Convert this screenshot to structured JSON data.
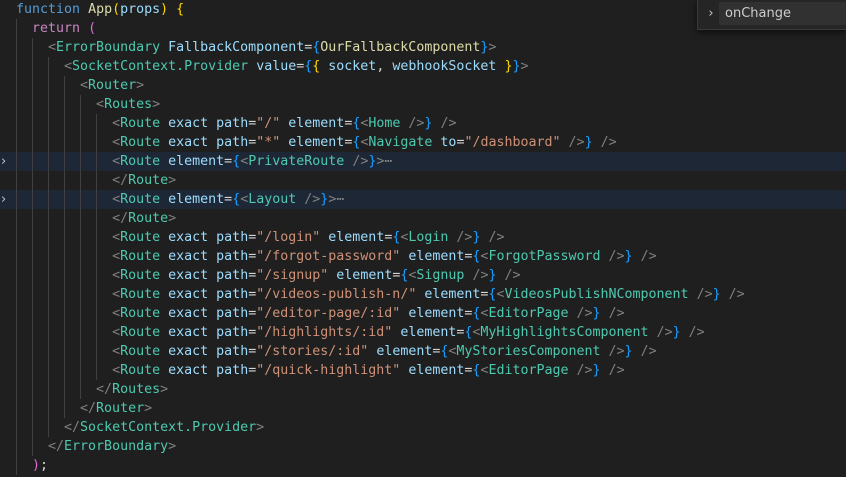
{
  "find_widget": {
    "toggle_icon": "chevron-right-icon",
    "toggle_glyph": "›",
    "query": "onChange"
  },
  "fold_glyph": "›",
  "code_lines": [
    {
      "indent": 0,
      "tokens": [
        [
          "k",
          "function"
        ],
        [
          "o",
          " "
        ],
        [
          "f",
          "App"
        ],
        [
          "p",
          "("
        ],
        [
          "v",
          "props"
        ],
        [
          "p",
          ")"
        ],
        [
          "o",
          " "
        ],
        [
          "p",
          "{"
        ]
      ]
    },
    {
      "indent": 2,
      "tokens": [
        [
          "r",
          "return"
        ],
        [
          "o",
          " "
        ],
        [
          "pk",
          "("
        ]
      ]
    },
    {
      "indent": 4,
      "tokens": [
        [
          "b",
          "<"
        ],
        [
          "t",
          "ErrorBoundary"
        ],
        [
          "o",
          " "
        ],
        [
          "a",
          "FallbackComponent"
        ],
        [
          "o",
          "="
        ],
        [
          "c",
          "{"
        ],
        [
          "y",
          "OurFallbackComponent"
        ],
        [
          "c",
          "}"
        ],
        [
          "b",
          ">"
        ]
      ]
    },
    {
      "indent": 6,
      "tokens": [
        [
          "b",
          "<"
        ],
        [
          "t",
          "SocketContext.Provider"
        ],
        [
          "o",
          " "
        ],
        [
          "a",
          "value"
        ],
        [
          "o",
          "="
        ],
        [
          "c",
          "{"
        ],
        [
          "p",
          "{"
        ],
        [
          "o",
          " "
        ],
        [
          "v",
          "socket"
        ],
        [
          "o",
          ", "
        ],
        [
          "v",
          "webhookSocket"
        ],
        [
          "o",
          " "
        ],
        [
          "p",
          "}"
        ],
        [
          "c",
          "}"
        ],
        [
          "b",
          ">"
        ]
      ]
    },
    {
      "indent": 8,
      "tokens": [
        [
          "b",
          "<"
        ],
        [
          "t",
          "Router"
        ],
        [
          "b",
          ">"
        ]
      ]
    },
    {
      "indent": 10,
      "tokens": [
        [
          "b",
          "<"
        ],
        [
          "t",
          "Routes"
        ],
        [
          "b",
          ">"
        ]
      ]
    },
    {
      "indent": 12,
      "tokens": [
        [
          "b",
          "<"
        ],
        [
          "t",
          "Route"
        ],
        [
          "o",
          " "
        ],
        [
          "a",
          "exact"
        ],
        [
          "o",
          " "
        ],
        [
          "a",
          "path"
        ],
        [
          "o",
          "="
        ],
        [
          "s",
          "\"/\""
        ],
        [
          "o",
          " "
        ],
        [
          "a",
          "element"
        ],
        [
          "o",
          "="
        ],
        [
          "c",
          "{"
        ],
        [
          "b",
          "<"
        ],
        [
          "t",
          "Home"
        ],
        [
          "o",
          " "
        ],
        [
          "b",
          "/>"
        ],
        [
          "c",
          "}"
        ],
        [
          "o",
          " "
        ],
        [
          "b",
          "/>"
        ]
      ]
    },
    {
      "indent": 12,
      "tokens": [
        [
          "b",
          "<"
        ],
        [
          "t",
          "Route"
        ],
        [
          "o",
          " "
        ],
        [
          "a",
          "exact"
        ],
        [
          "o",
          " "
        ],
        [
          "a",
          "path"
        ],
        [
          "o",
          "="
        ],
        [
          "s",
          "\"*\""
        ],
        [
          "o",
          " "
        ],
        [
          "a",
          "element"
        ],
        [
          "o",
          "="
        ],
        [
          "c",
          "{"
        ],
        [
          "b",
          "<"
        ],
        [
          "t",
          "Navigate"
        ],
        [
          "o",
          " "
        ],
        [
          "a",
          "to"
        ],
        [
          "o",
          "="
        ],
        [
          "s",
          "\"/dashboard\""
        ],
        [
          "o",
          " "
        ],
        [
          "b",
          "/>"
        ],
        [
          "c",
          "}"
        ],
        [
          "o",
          " "
        ],
        [
          "b",
          "/>"
        ]
      ]
    },
    {
      "indent": 12,
      "folded": true,
      "tokens": [
        [
          "b",
          "<"
        ],
        [
          "t",
          "Route"
        ],
        [
          "o",
          " "
        ],
        [
          "a",
          "element"
        ],
        [
          "o",
          "="
        ],
        [
          "c",
          "{"
        ],
        [
          "b",
          "<"
        ],
        [
          "t",
          "PrivateRoute"
        ],
        [
          "o",
          " "
        ],
        [
          "b",
          "/>"
        ],
        [
          "c",
          "}"
        ],
        [
          "b",
          ">"
        ],
        [
          "e",
          "⋯"
        ]
      ]
    },
    {
      "indent": 12,
      "tokens": [
        [
          "b",
          "</"
        ],
        [
          "t",
          "Route"
        ],
        [
          "b",
          ">"
        ]
      ]
    },
    {
      "indent": 12,
      "folded": true,
      "tokens": [
        [
          "b",
          "<"
        ],
        [
          "t",
          "Route"
        ],
        [
          "o",
          " "
        ],
        [
          "a",
          "element"
        ],
        [
          "o",
          "="
        ],
        [
          "c",
          "{"
        ],
        [
          "b",
          "<"
        ],
        [
          "t",
          "Layout"
        ],
        [
          "o",
          " "
        ],
        [
          "b",
          "/>"
        ],
        [
          "c",
          "}"
        ],
        [
          "b",
          ">"
        ],
        [
          "e",
          "⋯"
        ]
      ]
    },
    {
      "indent": 12,
      "tokens": [
        [
          "b",
          "</"
        ],
        [
          "t",
          "Route"
        ],
        [
          "b",
          ">"
        ]
      ]
    },
    {
      "indent": 12,
      "tokens": [
        [
          "b",
          "<"
        ],
        [
          "t",
          "Route"
        ],
        [
          "o",
          " "
        ],
        [
          "a",
          "exact"
        ],
        [
          "o",
          " "
        ],
        [
          "a",
          "path"
        ],
        [
          "o",
          "="
        ],
        [
          "s",
          "\"/login\""
        ],
        [
          "o",
          " "
        ],
        [
          "a",
          "element"
        ],
        [
          "o",
          "="
        ],
        [
          "c",
          "{"
        ],
        [
          "b",
          "<"
        ],
        [
          "t",
          "Login"
        ],
        [
          "o",
          " "
        ],
        [
          "b",
          "/>"
        ],
        [
          "c",
          "}"
        ],
        [
          "o",
          " "
        ],
        [
          "b",
          "/>"
        ]
      ]
    },
    {
      "indent": 12,
      "tokens": [
        [
          "b",
          "<"
        ],
        [
          "t",
          "Route"
        ],
        [
          "o",
          " "
        ],
        [
          "a",
          "exact"
        ],
        [
          "o",
          " "
        ],
        [
          "a",
          "path"
        ],
        [
          "o",
          "="
        ],
        [
          "s",
          "\"/forgot-password\""
        ],
        [
          "o",
          " "
        ],
        [
          "a",
          "element"
        ],
        [
          "o",
          "="
        ],
        [
          "c",
          "{"
        ],
        [
          "b",
          "<"
        ],
        [
          "t",
          "ForgotPassword"
        ],
        [
          "o",
          " "
        ],
        [
          "b",
          "/>"
        ],
        [
          "c",
          "}"
        ],
        [
          "o",
          " "
        ],
        [
          "b",
          "/>"
        ]
      ]
    },
    {
      "indent": 12,
      "tokens": [
        [
          "b",
          "<"
        ],
        [
          "t",
          "Route"
        ],
        [
          "o",
          " "
        ],
        [
          "a",
          "exact"
        ],
        [
          "o",
          " "
        ],
        [
          "a",
          "path"
        ],
        [
          "o",
          "="
        ],
        [
          "s",
          "\"/signup\""
        ],
        [
          "o",
          " "
        ],
        [
          "a",
          "element"
        ],
        [
          "o",
          "="
        ],
        [
          "c",
          "{"
        ],
        [
          "b",
          "<"
        ],
        [
          "t",
          "Signup"
        ],
        [
          "o",
          " "
        ],
        [
          "b",
          "/>"
        ],
        [
          "c",
          "}"
        ],
        [
          "o",
          " "
        ],
        [
          "b",
          "/>"
        ]
      ]
    },
    {
      "indent": 12,
      "tokens": [
        [
          "b",
          "<"
        ],
        [
          "t",
          "Route"
        ],
        [
          "o",
          " "
        ],
        [
          "a",
          "exact"
        ],
        [
          "o",
          " "
        ],
        [
          "a",
          "path"
        ],
        [
          "o",
          "="
        ],
        [
          "s",
          "\"/videos-publish-n/\""
        ],
        [
          "o",
          " "
        ],
        [
          "a",
          "element"
        ],
        [
          "o",
          "="
        ],
        [
          "c",
          "{"
        ],
        [
          "b",
          "<"
        ],
        [
          "t",
          "VideosPublishNComponent"
        ],
        [
          "o",
          " "
        ],
        [
          "b",
          "/>"
        ],
        [
          "c",
          "}"
        ],
        [
          "o",
          " "
        ],
        [
          "b",
          "/>"
        ]
      ]
    },
    {
      "indent": 12,
      "tokens": [
        [
          "b",
          "<"
        ],
        [
          "t",
          "Route"
        ],
        [
          "o",
          " "
        ],
        [
          "a",
          "exact"
        ],
        [
          "o",
          " "
        ],
        [
          "a",
          "path"
        ],
        [
          "o",
          "="
        ],
        [
          "s",
          "\"/editor-page/:id\""
        ],
        [
          "o",
          " "
        ],
        [
          "a",
          "element"
        ],
        [
          "o",
          "="
        ],
        [
          "c",
          "{"
        ],
        [
          "b",
          "<"
        ],
        [
          "t",
          "EditorPage"
        ],
        [
          "o",
          " "
        ],
        [
          "b",
          "/>"
        ],
        [
          "c",
          "}"
        ],
        [
          "o",
          " "
        ],
        [
          "b",
          "/>"
        ]
      ]
    },
    {
      "indent": 12,
      "tokens": [
        [
          "b",
          "<"
        ],
        [
          "t",
          "Route"
        ],
        [
          "o",
          " "
        ],
        [
          "a",
          "exact"
        ],
        [
          "o",
          " "
        ],
        [
          "a",
          "path"
        ],
        [
          "o",
          "="
        ],
        [
          "s",
          "\"/highlights/:id\""
        ],
        [
          "o",
          " "
        ],
        [
          "a",
          "element"
        ],
        [
          "o",
          "="
        ],
        [
          "c",
          "{"
        ],
        [
          "b",
          "<"
        ],
        [
          "t",
          "MyHighlightsComponent"
        ],
        [
          "o",
          " "
        ],
        [
          "b",
          "/>"
        ],
        [
          "c",
          "}"
        ],
        [
          "o",
          " "
        ],
        [
          "b",
          "/>"
        ]
      ]
    },
    {
      "indent": 12,
      "tokens": [
        [
          "b",
          "<"
        ],
        [
          "t",
          "Route"
        ],
        [
          "o",
          " "
        ],
        [
          "a",
          "exact"
        ],
        [
          "o",
          " "
        ],
        [
          "a",
          "path"
        ],
        [
          "o",
          "="
        ],
        [
          "s",
          "\"/stories/:id\""
        ],
        [
          "o",
          " "
        ],
        [
          "a",
          "element"
        ],
        [
          "o",
          "="
        ],
        [
          "c",
          "{"
        ],
        [
          "b",
          "<"
        ],
        [
          "t",
          "MyStoriesComponent"
        ],
        [
          "o",
          " "
        ],
        [
          "b",
          "/>"
        ],
        [
          "c",
          "}"
        ],
        [
          "o",
          " "
        ],
        [
          "b",
          "/>"
        ]
      ]
    },
    {
      "indent": 12,
      "tokens": [
        [
          "b",
          "<"
        ],
        [
          "t",
          "Route"
        ],
        [
          "o",
          " "
        ],
        [
          "a",
          "exact"
        ],
        [
          "o",
          " "
        ],
        [
          "a",
          "path"
        ],
        [
          "o",
          "="
        ],
        [
          "s",
          "\"/quick-highlight\""
        ],
        [
          "o",
          " "
        ],
        [
          "a",
          "element"
        ],
        [
          "o",
          "="
        ],
        [
          "c",
          "{"
        ],
        [
          "b",
          "<"
        ],
        [
          "t",
          "EditorPage"
        ],
        [
          "o",
          " "
        ],
        [
          "b",
          "/>"
        ],
        [
          "c",
          "}"
        ],
        [
          "o",
          " "
        ],
        [
          "b",
          "/>"
        ]
      ]
    },
    {
      "indent": 10,
      "tokens": [
        [
          "b",
          "</"
        ],
        [
          "t",
          "Routes"
        ],
        [
          "b",
          ">"
        ]
      ]
    },
    {
      "indent": 8,
      "tokens": [
        [
          "b",
          "</"
        ],
        [
          "t",
          "Router"
        ],
        [
          "b",
          ">"
        ]
      ]
    },
    {
      "indent": 6,
      "tokens": [
        [
          "b",
          "</"
        ],
        [
          "t",
          "SocketContext.Provider"
        ],
        [
          "b",
          ">"
        ]
      ]
    },
    {
      "indent": 4,
      "tokens": [
        [
          "b",
          "</"
        ],
        [
          "t",
          "ErrorBoundary"
        ],
        [
          "b",
          ">"
        ]
      ]
    },
    {
      "indent": 2,
      "tokens": [
        [
          "pk",
          ")"
        ],
        [
          "o",
          ";"
        ]
      ]
    }
  ]
}
